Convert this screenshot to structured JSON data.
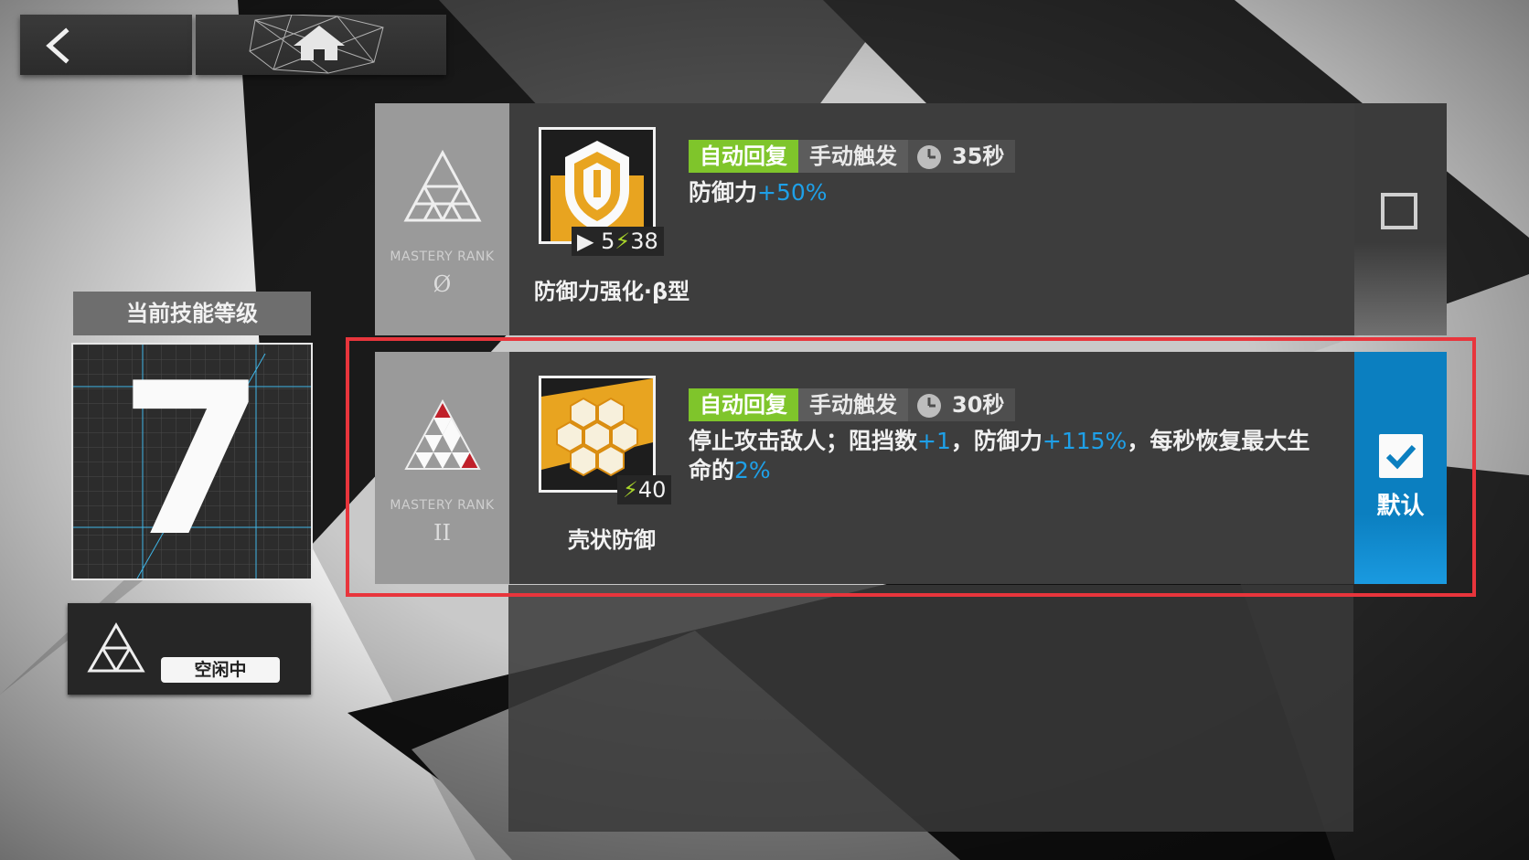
{
  "nav": {
    "back_icon": "chevron-left-icon",
    "home_icon": "home-icon"
  },
  "level_panel": {
    "header": "当前技能等级",
    "level": "7"
  },
  "status": {
    "label": "空闲中",
    "icon": "mastery-triangle-icon"
  },
  "skills": [
    {
      "mastery_label": "MASTERY RANK",
      "mastery_rank": "Ø",
      "name": "防御力强化·β型",
      "icon": "shield-icon",
      "initial_sp": "5",
      "sp_cost": "38",
      "tag_auto": "自动回复",
      "tag_manual": "手动触发",
      "duration": "35秒",
      "desc_plain_1": "防御力",
      "desc_hl_1": "+50%",
      "selected": false
    },
    {
      "mastery_label": "MASTERY RANK",
      "mastery_rank": "II",
      "name": "壳状防御",
      "icon": "honeycomb-shell-icon",
      "sp_cost": "40",
      "tag_auto": "自动回复",
      "tag_manual": "手动触发",
      "duration": "30秒",
      "desc_plain_1": "停止攻击敌人；阻挡数",
      "desc_hl_1": "+1",
      "desc_plain_2": "，防御力",
      "desc_hl_2": "+115%",
      "desc_plain_3": "，每秒恢复最大生命的",
      "desc_hl_3": "2%",
      "selected": true,
      "default_label": "默认"
    }
  ],
  "colors": {
    "auto_tag": "#7fc52b",
    "highlight_text": "#1ea0e8",
    "selected_bg": "#0b7fc0",
    "frame": "#e8353c"
  }
}
